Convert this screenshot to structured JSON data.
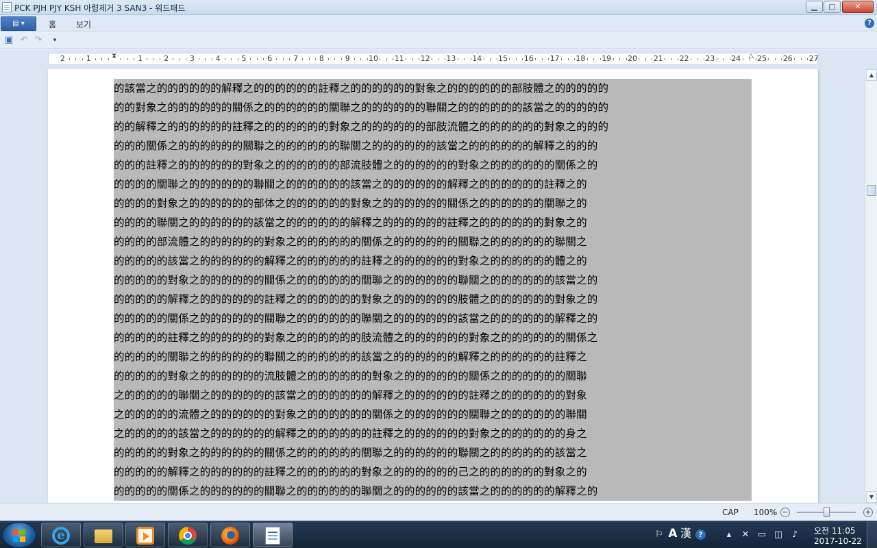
{
  "window": {
    "title": "PCK PJH PJY KSH 아령제거 3 SAN3 - 워드패드",
    "min_glyph": "▁",
    "max_glyph": "▢",
    "close_glyph": "✕"
  },
  "ribbon": {
    "app_menu_glyph": "▤ ▾",
    "tabs": [
      "홈",
      "보기"
    ],
    "help_glyph": "?"
  },
  "quick_access": {
    "save_glyph": "▣",
    "undo_glyph": "↶",
    "redo_glyph": "↷",
    "customize_glyph": "▾"
  },
  "ruler": {
    "labels": [
      "2",
      "1",
      "",
      "1",
      "2",
      "3",
      "4",
      "5",
      "6",
      "7",
      "8",
      "9",
      "10",
      "11",
      "12",
      "13",
      "14",
      "15",
      "16",
      "17",
      "18",
      "19",
      "20",
      "21",
      "22",
      "23",
      "24",
      "25",
      "26",
      "27"
    ]
  },
  "document": {
    "lines": [
      "的該當之的的的的的的解釋之的的的的的的註釋之的的的的的的對象之的的的的的的部肢體之的的的的的",
      "的的對象之的的的的的的關係之的的的的的的關聯之的的的的的的聯關之的的的的的的該當之的的的的的",
      "的的解釋之的的的的的的註釋之的的的的的的對象之的的的的的的部肢流體之的的的的的的對象之的的的",
      "的的的關係之的的的的的的關聯之的的的的的的聯關之的的的的的的該當之的的的的的的解釋之的的的",
      "的的的註釋之的的的的的的對象之的的的的的的部流肢體之的的的的的的對象之的的的的的的關係之的",
      "的的的的關聯之的的的的的的聯關之的的的的的的該當之的的的的的的解釋之的的的的的的註釋之的",
      "的的的的對象之的的的的的的部体之的的的的的的對象之的的的的的的關係之的的的的的的關聯之的",
      "的的的的聯關之的的的的的的該當之的的的的的的解釋之的的的的的的註釋之的的的的的的對象之的",
      "的的的的部流體之的的的的的的對象之的的的的的的關係之的的的的的的關聯之的的的的的的聯關之",
      "的的的的的該當之的的的的的的解釋之的的的的的的註釋之的的的的的的對象之的的的的的的體之的",
      "的的的的的對象之的的的的的的關係之的的的的的的關聯之的的的的的的聯關之的的的的的的該當之的",
      "的的的的的解釋之的的的的的的註釋之的的的的的的對象之的的的的的的肢體之的的的的的的對象之的",
      "的的的的的關係之的的的的的的關聯之的的的的的的聯關之的的的的的的該當之的的的的的的解釋之的",
      "的的的的的註釋之的的的的的的對象之的的的的的的肢流體之的的的的的的對象之的的的的的的關係之",
      "的的的的的關聯之的的的的的的聯關之的的的的的的該當之的的的的的的解釋之的的的的的的註釋之",
      "的的的的的對象之的的的的的的流肢體之的的的的的的對象之的的的的的的關係之的的的的的的關聯",
      "之的的的的的聯關之的的的的的的該當之的的的的的的解釋之的的的的的的註釋之的的的的的的對象",
      "之的的的的的流體之的的的的的的對象之的的的的的的關係之的的的的的的關聯之的的的的的的聯關",
      "之的的的的的該當之的的的的的的解釋之的的的的的的註釋之的的的的的的對象之的的的的的的身之",
      "的的的的的對象之的的的的的的關係之的的的的的的關聯之的的的的的的聯關之的的的的的的該當之",
      "的的的的的解釋之的的的的的的註釋之的的的的的的對象之的的的的的的己之的的的的的的對象之的",
      "的的的的的關係之的的的的的的關聯之的的的的的的聯關之的的的的的的該當之的的的的的的解釋之的"
    ]
  },
  "scrollbar": {
    "up_glyph": "▲",
    "down_glyph": "▼",
    "position_fraction": 0.26
  },
  "status": {
    "cap": "CAP",
    "zoom": "100%",
    "zoom_out_glyph": "−",
    "zoom_in_glyph": "+"
  },
  "taskbar": {
    "apps": [
      "internet-explorer",
      "file-explorer",
      "media-player",
      "chrome",
      "firefox",
      "wordpad"
    ],
    "tray": {
      "ime_mode": "A",
      "ime_hanja": "漢",
      "help_glyph": "?",
      "icons": [
        "⚐",
        "▴",
        "✕",
        "▭",
        "◫",
        "♪"
      ]
    },
    "clock": {
      "time": "오전 11:05",
      "date": "2017-10-22"
    }
  }
}
